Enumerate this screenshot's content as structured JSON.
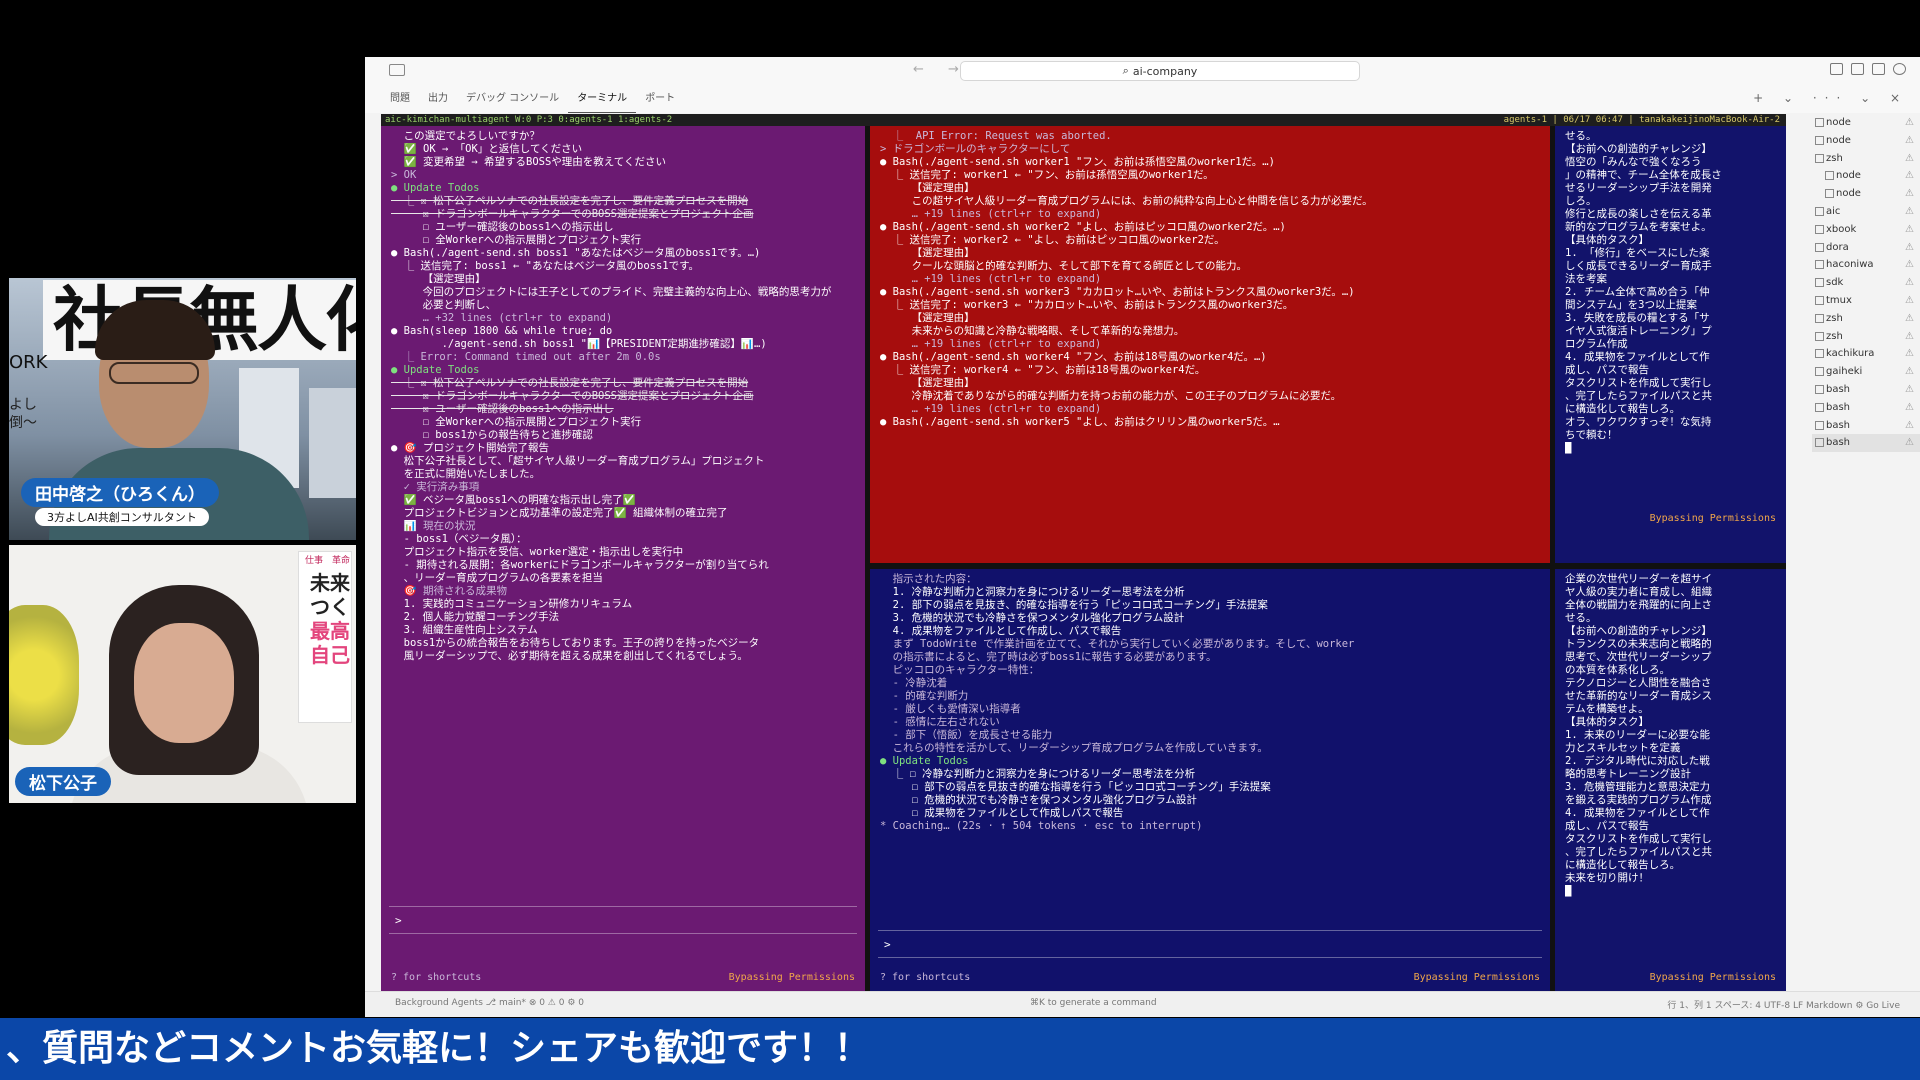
{
  "window": {
    "search_text": "ai-company",
    "tabs": [
      "問題",
      "出力",
      "デバッグ コンソール",
      "ターミナル",
      "ポート"
    ],
    "active_tab": "ターミナル",
    "panel_actions": "+ ⌄ ··· ⌄ ×"
  },
  "tmux_status": {
    "left": "aic-kimichan-multiagent W:0 P:3 0:agents-1    1:agents-2",
    "right": "agents-1 | 06/17 06:47 | tanakakeijinoMacBook-Air-2"
  },
  "president": {
    "lines": [
      {
        "t": "  この選定でよろしいですか？",
        "c": ""
      },
      {
        "t": "  ✅ OK → 「OK」と返信してください",
        "c": ""
      },
      {
        "t": "  ✅ 変更希望 → 希望するBOSSや理由を教えてください",
        "c": ""
      },
      {
        "t": "",
        "c": ""
      },
      {
        "t": "> OK",
        "c": "dim"
      },
      {
        "t": "",
        "c": ""
      },
      {
        "t": "● Update Todos",
        "c": "bullet"
      },
      {
        "t": "  ⎿ ☒ 松下公子ペルソナでの社長設定を完了し、要件定義プロセスを開始",
        "c": "strike"
      },
      {
        "t": "     ☒ ドラゴンボールキャラクターでのBOSS選定提案とプロジェクト企画",
        "c": "strike"
      },
      {
        "t": "     ☐ ユーザー確認後のboss1への指示出し",
        "c": ""
      },
      {
        "t": "     ☐ 全Workerへの指示展開とプロジェクト実行",
        "c": ""
      },
      {
        "t": "",
        "c": ""
      },
      {
        "t": "● Bash(./agent-send.sh boss1 \"あなたはベジータ風のboss1です。…)",
        "c": ""
      },
      {
        "t": "  ⎿ 送信完了: boss1 ← \"あなたはベジータ風のboss1です。",
        "c": ""
      },
      {
        "t": "",
        "c": ""
      },
      {
        "t": "     【選定理由】",
        "c": ""
      },
      {
        "t": "     今回のプロジェクトには王子としてのプライド、完璧主義的な向上心、戦略的思考力が",
        "c": ""
      },
      {
        "t": "     必要と判断し、",
        "c": ""
      },
      {
        "t": "     … +32 lines (ctrl+r to expand)",
        "c": "dim"
      },
      {
        "t": "",
        "c": ""
      },
      {
        "t": "● Bash(sleep 1800 && while true; do",
        "c": ""
      },
      {
        "t": "        ./agent-send.sh boss1 \"📊【PRESIDENT定期進捗確認】📊…)",
        "c": ""
      },
      {
        "t": "  ⎿ Error: Command timed out after 2m 0.0s",
        "c": "dim"
      },
      {
        "t": "",
        "c": ""
      },
      {
        "t": "● Update Todos",
        "c": "bullet"
      },
      {
        "t": "  ⎿ ☒ 松下公子ペルソナでの社長設定を完了し、要件定義プロセスを開始",
        "c": "strike"
      },
      {
        "t": "     ☒ ドラゴンボールキャラクターでのBOSS選定提案とプロジェクト企画",
        "c": "strike"
      },
      {
        "t": "     ☒ ユーザー確認後のboss1への指示出し",
        "c": "strike"
      },
      {
        "t": "     ☐ 全Workerへの指示展開とプロジェクト実行",
        "c": ""
      },
      {
        "t": "     ☐ boss1からの報告待ちと進捗確認",
        "c": ""
      },
      {
        "t": "",
        "c": ""
      },
      {
        "t": "● 🎯 プロジェクト開始完了報告",
        "c": ""
      },
      {
        "t": "",
        "c": ""
      },
      {
        "t": "  松下公子社長として、「超サイヤ人級リーダー育成プログラム」プロジェクト",
        "c": ""
      },
      {
        "t": "  を正式に開始いたしました。",
        "c": ""
      },
      {
        "t": "",
        "c": ""
      },
      {
        "t": "  ✓ 実行済み事項",
        "c": "dim"
      },
      {
        "t": "",
        "c": ""
      },
      {
        "t": "  ✅ ベジータ風boss1への明確な指示出し完了✅",
        "c": ""
      },
      {
        "t": "  プロジェクトビジョンと成功基準の設定完了✅ 組織体制の確立完了",
        "c": ""
      },
      {
        "t": "",
        "c": ""
      },
      {
        "t": "  📊 現在の状況",
        "c": "dim"
      },
      {
        "t": "",
        "c": ""
      },
      {
        "t": "  - boss1（ベジータ風）：",
        "c": ""
      },
      {
        "t": "  プロジェクト指示を受信、worker選定・指示出しを実行中",
        "c": ""
      },
      {
        "t": "  - 期待される展開：各workerにドラゴンボールキャラクターが割り当てられ",
        "c": ""
      },
      {
        "t": "  、リーダー育成プログラムの各要素を担当",
        "c": ""
      },
      {
        "t": "",
        "c": ""
      },
      {
        "t": "  🎯 期待される成果物",
        "c": "dim"
      },
      {
        "t": "",
        "c": ""
      },
      {
        "t": "  1. 実践的コミュニケーション研修カリキュラム",
        "c": ""
      },
      {
        "t": "  2. 個人能力覚醒コーチング手法",
        "c": ""
      },
      {
        "t": "  3. 組織生産性向上システム",
        "c": ""
      },
      {
        "t": "",
        "c": ""
      },
      {
        "t": "  boss1からの統合報告をお待ちしております。王子の誇りを持ったベジータ",
        "c": ""
      },
      {
        "t": "  風リーダーシップで、必ず期待を超える成果を創出してくれるでしょう。",
        "c": ""
      }
    ],
    "prompt": ">",
    "shortcuts": "? for shortcuts",
    "permissions": "Bypassing Permissions"
  },
  "boss1": {
    "lines": [
      {
        "t": "  ⎿  API Error: Request was aborted.",
        "c": "dim"
      },
      {
        "t": "",
        "c": ""
      },
      {
        "t": "> ドラゴンボールのキャラクターにして",
        "c": "dim"
      },
      {
        "t": "",
        "c": ""
      },
      {
        "t": "● Bash(./agent-send.sh worker1 \"フン、お前は孫悟空風のworker1だ。…)",
        "c": ""
      },
      {
        "t": "  ⎿ 送信完了: worker1 ← \"フン、お前は孫悟空風のworker1だ。",
        "c": ""
      },
      {
        "t": "",
        "c": ""
      },
      {
        "t": "     【選定理由】",
        "c": ""
      },
      {
        "t": "     この超サイヤ人級リーダー育成プログラムには、お前の純粋な向上心と仲間を信じる力が必要だ。",
        "c": ""
      },
      {
        "t": "     … +19 lines (ctrl+r to expand)",
        "c": "dim"
      },
      {
        "t": "",
        "c": ""
      },
      {
        "t": "● Bash(./agent-send.sh worker2 \"よし、お前はピッコロ風のworker2だ。…)",
        "c": ""
      },
      {
        "t": "  ⎿ 送信完了: worker2 ← \"よし、お前はピッコロ風のworker2だ。",
        "c": ""
      },
      {
        "t": "",
        "c": ""
      },
      {
        "t": "     【選定理由】",
        "c": ""
      },
      {
        "t": "     クールな頭脳と的確な判断力、そして部下を育てる師匠としての能力。",
        "c": ""
      },
      {
        "t": "     … +19 lines (ctrl+r to expand)",
        "c": "dim"
      },
      {
        "t": "",
        "c": ""
      },
      {
        "t": "● Bash(./agent-send.sh worker3 \"カカロット…いや、お前はトランクス風のworker3だ。…)",
        "c": ""
      },
      {
        "t": "  ⎿ 送信完了: worker3 ← \"カカロット…いや、お前はトランクス風のworker3だ。",
        "c": ""
      },
      {
        "t": "",
        "c": ""
      },
      {
        "t": "     【選定理由】",
        "c": ""
      },
      {
        "t": "     未来からの知識と冷静な戦略眼、そして革新的な発想力。",
        "c": ""
      },
      {
        "t": "     … +19 lines (ctrl+r to expand)",
        "c": "dim"
      },
      {
        "t": "",
        "c": ""
      },
      {
        "t": "● Bash(./agent-send.sh worker4 \"フン、お前は18号風のworker4だ。…)",
        "c": ""
      },
      {
        "t": "  ⎿ 送信完了: worker4 ← \"フン、お前は18号風のworker4だ。",
        "c": ""
      },
      {
        "t": "",
        "c": ""
      },
      {
        "t": "     【選定理由】",
        "c": ""
      },
      {
        "t": "     冷静沈着でありながら的確な判断力を持つお前の能力が、この王子のプログラムに必要だ。",
        "c": ""
      },
      {
        "t": "     … +19 lines (ctrl+r to expand)",
        "c": "dim"
      },
      {
        "t": "",
        "c": ""
      },
      {
        "t": "● Bash(./agent-send.sh worker5 \"よし、お前はクリリン風のworker5だ。…",
        "c": ""
      }
    ]
  },
  "worker_a": {
    "lines": [
      {
        "t": "せる。",
        "c": ""
      },
      {
        "t": "",
        "c": ""
      },
      {
        "t": "【お前への創造的チャレンジ】",
        "c": ""
      },
      {
        "t": "悟空の「みんなで強くなろう",
        "c": ""
      },
      {
        "t": "」の精神で、チーム全体を成長さ",
        "c": ""
      },
      {
        "t": "せるリーダーシップ手法を開発",
        "c": ""
      },
      {
        "t": "しろ。",
        "c": ""
      },
      {
        "t": "修行と成長の楽しさを伝える革",
        "c": ""
      },
      {
        "t": "新的なプログラムを考案せよ。",
        "c": ""
      },
      {
        "t": "",
        "c": ""
      },
      {
        "t": "【具体的タスク】",
        "c": ""
      },
      {
        "t": "1. 「修行」をベースにした楽",
        "c": ""
      },
      {
        "t": "しく成長できるリーダー育成手",
        "c": ""
      },
      {
        "t": "法を考案",
        "c": ""
      },
      {
        "t": "2. チーム全体で高め合う「仲",
        "c": ""
      },
      {
        "t": "間システム」を3つ以上提案",
        "c": ""
      },
      {
        "t": "3. 失敗を成長の糧とする「サ",
        "c": ""
      },
      {
        "t": "イヤ人式復活トレーニング」プ",
        "c": ""
      },
      {
        "t": "ログラム作成",
        "c": ""
      },
      {
        "t": "4. 成果物をファイルとして作",
        "c": ""
      },
      {
        "t": "成し、パスで報告",
        "c": ""
      },
      {
        "t": "",
        "c": ""
      },
      {
        "t": "タスクリストを作成して実行し",
        "c": ""
      },
      {
        "t": "、完了したらファイルパスと共",
        "c": ""
      },
      {
        "t": "に構造化して報告しろ。",
        "c": ""
      },
      {
        "t": "オラ、ワクワクすっぞ！な気持",
        "c": ""
      },
      {
        "t": "ちで頼む！",
        "c": ""
      },
      {
        "t": "█",
        "c": ""
      }
    ],
    "permissions": "Bypassing Permissions"
  },
  "worker1": {
    "lines": [
      {
        "t": "  指示された内容：",
        "c": "dim"
      },
      {
        "t": "  1. 冷静な判断力と洞察力を身につけるリーダー思考法を分析",
        "c": ""
      },
      {
        "t": "  2. 部下の弱点を見抜き、的確な指導を行う「ピッコロ式コーチング」手法提案",
        "c": ""
      },
      {
        "t": "  3. 危機的状況でも冷静さを保つメンタル強化プログラム設計",
        "c": ""
      },
      {
        "t": "  4. 成果物をファイルとして作成し、パスで報告",
        "c": ""
      },
      {
        "t": "",
        "c": ""
      },
      {
        "t": "  まず TodoWrite で作業計画を立てて、それから実行していく必要があります。そして、worker",
        "c": "dim"
      },
      {
        "t": "  の指示書によると、完了時は必ずboss1に報告する必要があります。",
        "c": "dim"
      },
      {
        "t": "",
        "c": ""
      },
      {
        "t": "  ピッコロのキャラクター特性：",
        "c": "dim"
      },
      {
        "t": "  - 冷静沈着",
        "c": "dim"
      },
      {
        "t": "  - 的確な判断力",
        "c": "dim"
      },
      {
        "t": "  - 厳しくも愛情深い指導者",
        "c": "dim"
      },
      {
        "t": "  - 感情に左右されない",
        "c": "dim"
      },
      {
        "t": "  - 部下（悟飯）を成長させる能力",
        "c": "dim"
      },
      {
        "t": "",
        "c": ""
      },
      {
        "t": "  これらの特性を活かして、リーダーシップ育成プログラムを作成していきます。",
        "c": "dim"
      },
      {
        "t": "",
        "c": ""
      },
      {
        "t": "● Update Todos",
        "c": "bullet"
      },
      {
        "t": "  ⎿ ☐ 冷静な判断力と洞察力を身につけるリーダー思考法を分析",
        "c": ""
      },
      {
        "t": "     ☐ 部下の弱点を見抜き的確な指導を行う「ピッコロ式コーチング」手法提案",
        "c": ""
      },
      {
        "t": "     ☐ 危機的状況でも冷静さを保つメンタル強化プログラム設計",
        "c": ""
      },
      {
        "t": "     ☐ 成果物をファイルとして作成しパスで報告",
        "c": ""
      },
      {
        "t": "",
        "c": ""
      },
      {
        "t": "* Coaching… (22s · ↑ 504 tokens · esc to interrupt)",
        "c": "dim"
      }
    ],
    "prompt": ">",
    "shortcuts": "? for shortcuts",
    "permissions": "Bypassing Permissions"
  },
  "worker_b": {
    "lines": [
      {
        "t": "企業の次世代リーダーを超サイ",
        "c": ""
      },
      {
        "t": "ヤ人級の実力者に育成し、組織",
        "c": ""
      },
      {
        "t": "全体の戦闘力を飛躍的に向上さ",
        "c": ""
      },
      {
        "t": "せる。",
        "c": ""
      },
      {
        "t": "",
        "c": ""
      },
      {
        "t": "【お前への創造的チャレンジ】",
        "c": ""
      },
      {
        "t": "トランクスの未来志向と戦略的",
        "c": ""
      },
      {
        "t": "思考で、次世代リーダーシップ",
        "c": ""
      },
      {
        "t": "の本質を体系化しろ。",
        "c": ""
      },
      {
        "t": "テクノロジーと人間性を融合さ",
        "c": ""
      },
      {
        "t": "せた革新的なリーダー育成シス",
        "c": ""
      },
      {
        "t": "テムを構築せよ。",
        "c": ""
      },
      {
        "t": "",
        "c": ""
      },
      {
        "t": "【具体的タスク】",
        "c": ""
      },
      {
        "t": "1. 未来のリーダーに必要な能",
        "c": ""
      },
      {
        "t": "力とスキルセットを定義",
        "c": ""
      },
      {
        "t": "2. デジタル時代に対応した戦",
        "c": ""
      },
      {
        "t": "略的思考トレーニング設計",
        "c": ""
      },
      {
        "t": "3. 危機管理能力と意思決定力",
        "c": ""
      },
      {
        "t": "を鍛える実践的プログラム作成",
        "c": ""
      },
      {
        "t": "4. 成果物をファイルとして作",
        "c": ""
      },
      {
        "t": "成し、パスで報告",
        "c": ""
      },
      {
        "t": "",
        "c": ""
      },
      {
        "t": "タスクリストを作成して実行し",
        "c": ""
      },
      {
        "t": "、完了したらファイルパスと共",
        "c": ""
      },
      {
        "t": "に構造化して報告しろ。",
        "c": ""
      },
      {
        "t": "未来を切り開け！",
        "c": ""
      },
      {
        "t": "█",
        "c": ""
      }
    ],
    "permissions": "Bypassing Permissions"
  },
  "process_list": [
    {
      "name": "node",
      "sub": false
    },
    {
      "name": "node",
      "sub": false
    },
    {
      "name": "zsh",
      "sub": false
    },
    {
      "name": "node",
      "sub": true
    },
    {
      "name": "node",
      "sub": true
    },
    {
      "name": "aic",
      "sub": false
    },
    {
      "name": "xbook",
      "sub": false
    },
    {
      "name": "dora",
      "sub": false
    },
    {
      "name": "haconiwa",
      "sub": false
    },
    {
      "name": "sdk",
      "sub": false
    },
    {
      "name": "tmux",
      "sub": false
    },
    {
      "name": "zsh",
      "sub": false
    },
    {
      "name": "zsh",
      "sub": false
    },
    {
      "name": "kachikura",
      "sub": false
    },
    {
      "name": "gaiheki",
      "sub": false
    },
    {
      "name": "bash",
      "sub": false
    },
    {
      "name": "bash",
      "sub": false
    },
    {
      "name": "bash",
      "sub": false
    },
    {
      "name": "bash",
      "sub": false
    }
  ],
  "statusbar": {
    "left": "Background Agents   ⎇ main*   ⊗ 0 ⚠ 0   ⚙ 0",
    "center": "⌘K to generate a command",
    "right": "行 1、列 1   スペース: 4   UTF-8   LF   Markdown   ⚙ Go Live"
  },
  "webcam1": {
    "banner": "社長無人化",
    "side_text": "ORK",
    "side_text2": "よし\n倒〜",
    "name": "田中啓之（ひろくん）",
    "role": "3方よしAI共創コンサルタント"
  },
  "webcam2": {
    "book_top": "仕事　革命",
    "book_text_1": "未来",
    "book_text_2": "つく",
    "book_text_3": "最高",
    "book_text_4": "自己",
    "name": "松下公子"
  },
  "ticker": "、質問などコメントお気軽に！シェアも歓迎です！！"
}
